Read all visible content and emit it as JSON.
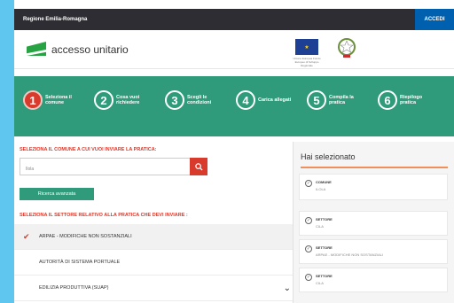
{
  "topbar": {
    "region": "Regione Emilia-Romagna",
    "login": "ACCEDI"
  },
  "header": {
    "app_name": "accesso unitario",
    "eu_text": "Unione Europea Fondo Europeo di Sviluppo Regionale"
  },
  "steps": [
    {
      "num": "1",
      "label": "Seleziona il comune"
    },
    {
      "num": "2",
      "label": "Cosa vuoi richiedere"
    },
    {
      "num": "3",
      "label": "Scegli le condizioni"
    },
    {
      "num": "4",
      "label": "Carica allegati"
    },
    {
      "num": "5",
      "label": "Compila la pratica"
    },
    {
      "num": "6",
      "label": "Riepilogo pratica"
    }
  ],
  "left": {
    "comune_title": "SELEZIONA IL COMUNE A CUI VUOI INVIARE LA PRATICA:",
    "search_value": "Ilola",
    "advanced_button": "Ricerca avanzata",
    "settore_title": "SELEZIONA IL SETTORE RELATIVO ALLA PRATICA CHE DEVI INVIARE :",
    "items": [
      {
        "label": "ARPAE - MODIFICHE NON SOSTANZIALI"
      },
      {
        "label": "AUTORITÀ DI SISTEMA PORTUALE"
      },
      {
        "label": "EDILIZIA PRODUTTIVA (SUAP)"
      }
    ]
  },
  "right": {
    "title": "Hai selezionato",
    "selections": [
      {
        "key": "COMUNE",
        "value": "ILOLA"
      },
      {
        "key": "SETTORE",
        "value": "CILA"
      },
      {
        "key": "SETTORE",
        "value": "ARPAE - MODIFICHE NON SOSTANZIALI"
      },
      {
        "key": "SETTORE",
        "value": "CILA"
      }
    ]
  },
  "colors": {
    "brand_green": "#2f9b7a",
    "accent_red": "#d83a2c",
    "login_blue": "#0060b0",
    "frame_blue": "#5ec6ef"
  },
  "icons": {
    "search": "search-icon",
    "check": "check-icon",
    "chevron": "chevron-down-icon",
    "selected": "check-circle-icon"
  }
}
